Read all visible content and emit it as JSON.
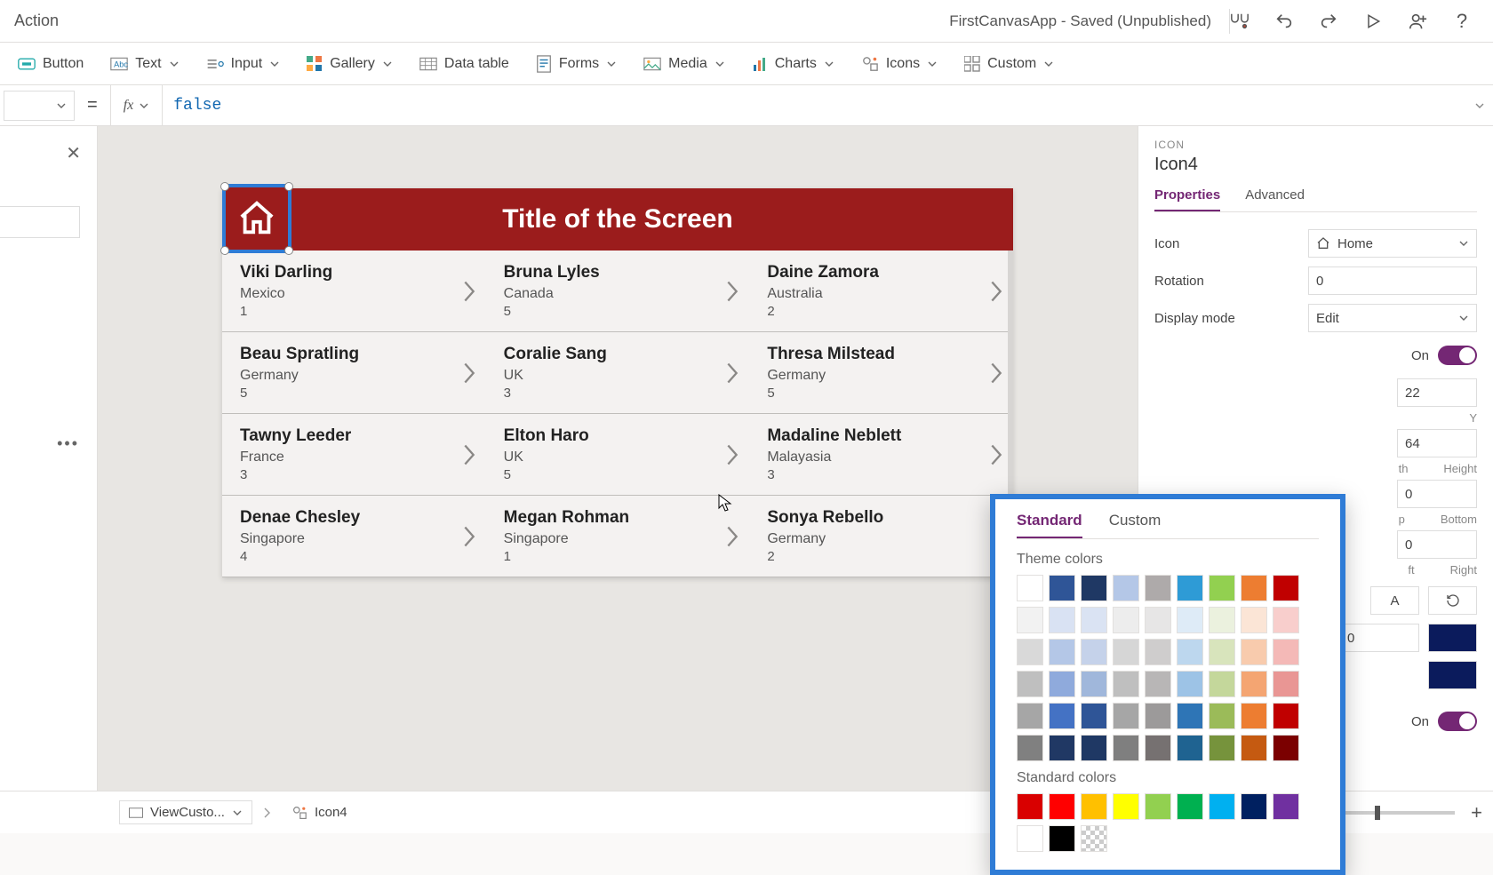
{
  "titlebar": {
    "action_label": "Action",
    "app_title": "FirstCanvasApp - Saved (Unpublished)"
  },
  "ribbon": {
    "button": "Button",
    "text": "Text",
    "input": "Input",
    "gallery": "Gallery",
    "datatable": "Data table",
    "forms": "Forms",
    "media": "Media",
    "charts": "Charts",
    "icons": "Icons",
    "custom": "Custom"
  },
  "formula": {
    "value": "false"
  },
  "screen": {
    "title": "Title of the Screen"
  },
  "gallery_rows": [
    [
      {
        "name": "Viki  Darling",
        "sub": "Mexico",
        "num": "1"
      },
      {
        "name": "Bruna  Lyles",
        "sub": "Canada",
        "num": "5"
      },
      {
        "name": "Daine  Zamora",
        "sub": "Australia",
        "num": "2"
      }
    ],
    [
      {
        "name": "Beau  Spratling",
        "sub": "Germany",
        "num": "5"
      },
      {
        "name": "Coralie  Sang",
        "sub": "UK",
        "num": "3"
      },
      {
        "name": "Thresa  Milstead",
        "sub": "Germany",
        "num": "5"
      }
    ],
    [
      {
        "name": "Tawny  Leeder",
        "sub": "France",
        "num": "3"
      },
      {
        "name": "Elton  Haro",
        "sub": "UK",
        "num": "5"
      },
      {
        "name": "Madaline  Neblett",
        "sub": "Malayasia",
        "num": "3"
      }
    ],
    [
      {
        "name": "Denae  Chesley",
        "sub": "Singapore",
        "num": "4"
      },
      {
        "name": "Megan  Rohman",
        "sub": "Singapore",
        "num": "1"
      },
      {
        "name": "Sonya  Rebello",
        "sub": "Germany",
        "num": "2"
      }
    ]
  ],
  "properties": {
    "category": "ICON",
    "name": "Icon4",
    "tab_properties": "Properties",
    "tab_advanced": "Advanced",
    "icon_label": "Icon",
    "icon_value": "Home",
    "rotation_label": "Rotation",
    "rotation_value": "0",
    "displaymode_label": "Display mode",
    "displaymode_value": "Edit",
    "on_label": "On",
    "x_value": "22",
    "y_label": "Y",
    "y_value": "64",
    "width_hint": "th",
    "height_label": "Height",
    "t_value": "0",
    "top_hint": "p",
    "bottom_label": "Bottom",
    "l_value": "0",
    "left_hint": "ft",
    "right_label": "Right",
    "num_zero": "0"
  },
  "color_picker": {
    "tab_standard": "Standard",
    "tab_custom": "Custom",
    "theme_label": "Theme colors",
    "standard_label": "Standard colors",
    "theme_colors": [
      [
        "#ffffff",
        "#2f5597",
        "#1f3864",
        "#b4c7e7",
        "#aeaaaa",
        "#2e9bd6",
        "#92d050",
        "#ed7d31",
        "#c00000"
      ],
      [
        "#f2f2f2",
        "#d9e2f3",
        "#dae3f3",
        "#ededed",
        "#e7e6e6",
        "#deebf7",
        "#ebf1de",
        "#fbe5d6",
        "#f8cecc"
      ],
      [
        "#d9d9d9",
        "#b4c7e7",
        "#c5d2ea",
        "#d6d6d6",
        "#cfcdcd",
        "#bdd7ee",
        "#d8e4bc",
        "#f8cbad",
        "#f4b9b7"
      ],
      [
        "#bfbfbf",
        "#8faadc",
        "#a0b7db",
        "#bfbfbf",
        "#b8b6b6",
        "#9dc3e6",
        "#c4d79b",
        "#f4a572",
        "#e99694"
      ],
      [
        "#a6a6a6",
        "#4472c4",
        "#2f5597",
        "#a6a6a6",
        "#9c9a9a",
        "#2e75b6",
        "#9bbb59",
        "#ed7d31",
        "#c00000"
      ],
      [
        "#808080",
        "#203864",
        "#1f3864",
        "#7f7f7f",
        "#767171",
        "#1f6391",
        "#76933c",
        "#c55a11",
        "#7b0000"
      ]
    ],
    "standard_colors": [
      [
        "#d90000",
        "#ff0000",
        "#ffc000",
        "#ffff00",
        "#92d050",
        "#00b050",
        "#00b0f0",
        "#002060",
        "#7030a0"
      ],
      [
        "#ffffff",
        "#000000",
        "checker"
      ]
    ]
  },
  "footer": {
    "crumb1": "ViewCusto...",
    "crumb2": "Icon4"
  }
}
